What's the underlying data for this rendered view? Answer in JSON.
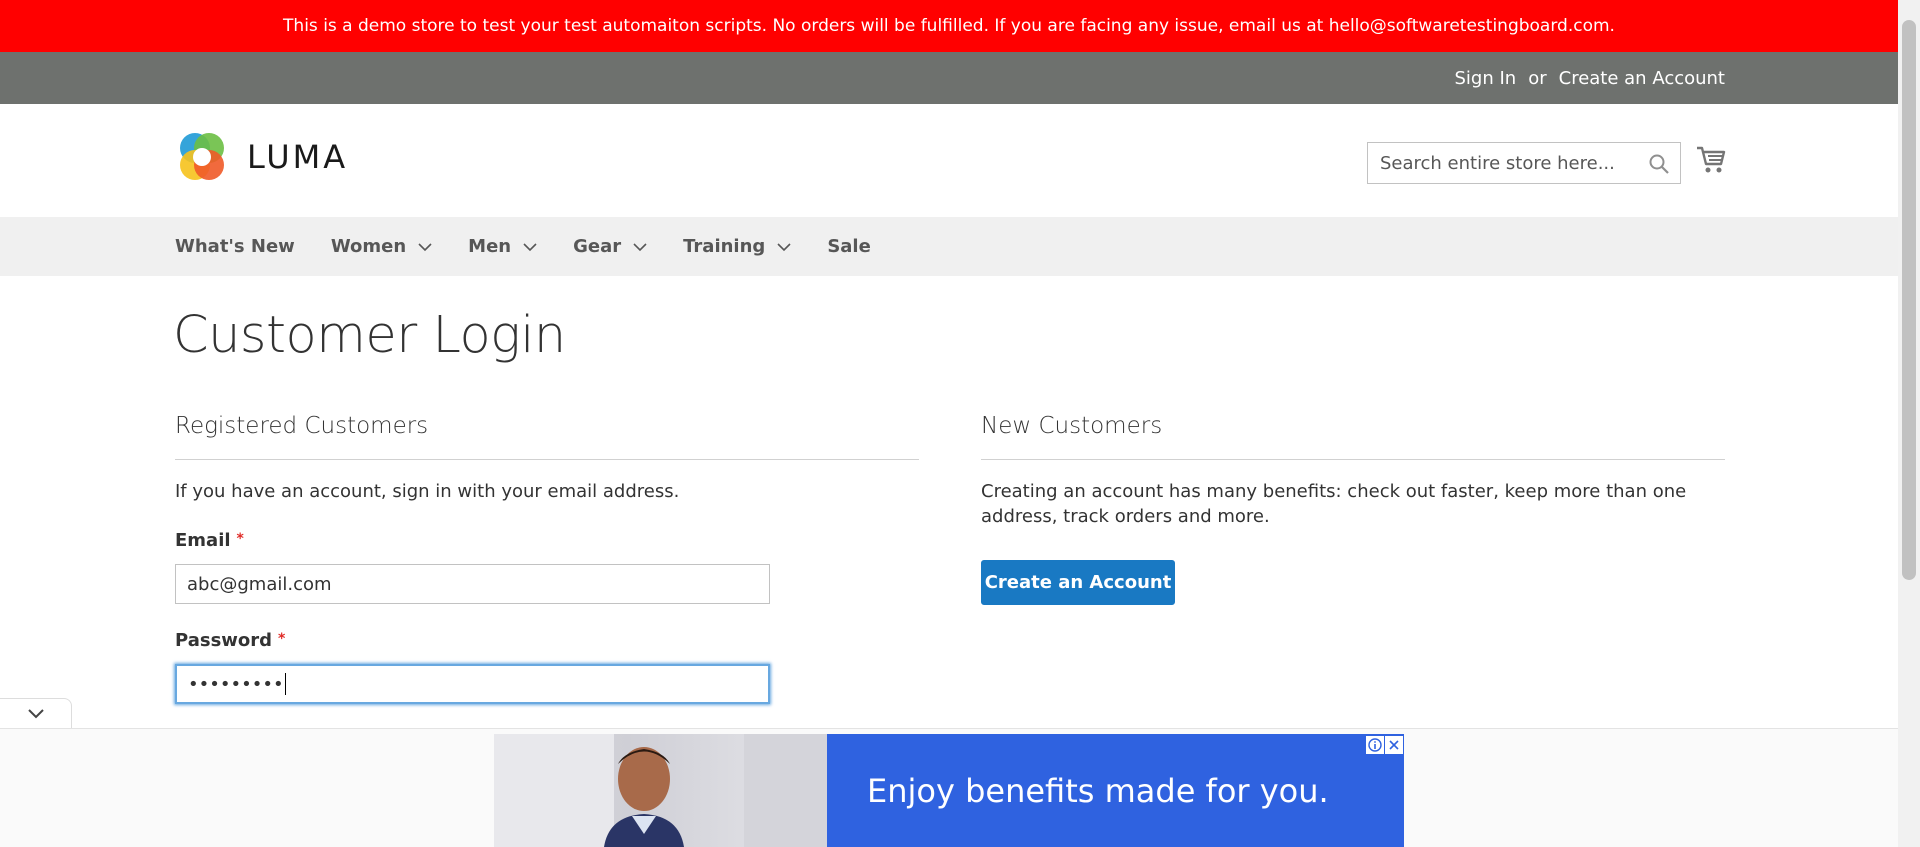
{
  "demo_banner": {
    "text": "This is a demo store to test your test automaiton scripts. No orders will be fulfilled. If you are facing any issue, email us at hello@softwaretestingboard.com."
  },
  "top_bar": {
    "sign_in": "Sign In",
    "or": "or",
    "create_account": "Create an Account"
  },
  "header": {
    "logo_text": "LUMA",
    "search": {
      "placeholder": "Search entire store here...",
      "value": ""
    }
  },
  "nav": {
    "items": [
      {
        "label": "What's New",
        "has_dropdown": false
      },
      {
        "label": "Women",
        "has_dropdown": true
      },
      {
        "label": "Men",
        "has_dropdown": true
      },
      {
        "label": "Gear",
        "has_dropdown": true
      },
      {
        "label": "Training",
        "has_dropdown": true
      },
      {
        "label": "Sale",
        "has_dropdown": false
      }
    ]
  },
  "main": {
    "title": "Customer Login",
    "registered": {
      "title": "Registered Customers",
      "intro": "If you have an account, sign in with your email address.",
      "email_label": "Email",
      "email_value": "abc@gmail.com",
      "password_label": "Password",
      "password_value": "•••••••••",
      "required_mark": "*"
    },
    "new_customers": {
      "title": "New Customers",
      "intro": "Creating an account has many benefits: check out faster, keep more than one address, track orders and more.",
      "button": "Create an Account"
    }
  },
  "ad": {
    "text": "Enjoy benefits made for you."
  },
  "colors": {
    "banner": "#ff0000",
    "top_bar": "#6e716e",
    "nav_bg": "#f0f0f0",
    "primary_button": "#1979c3",
    "ad_blue": "#2f62e0",
    "required": "#e02b27"
  }
}
